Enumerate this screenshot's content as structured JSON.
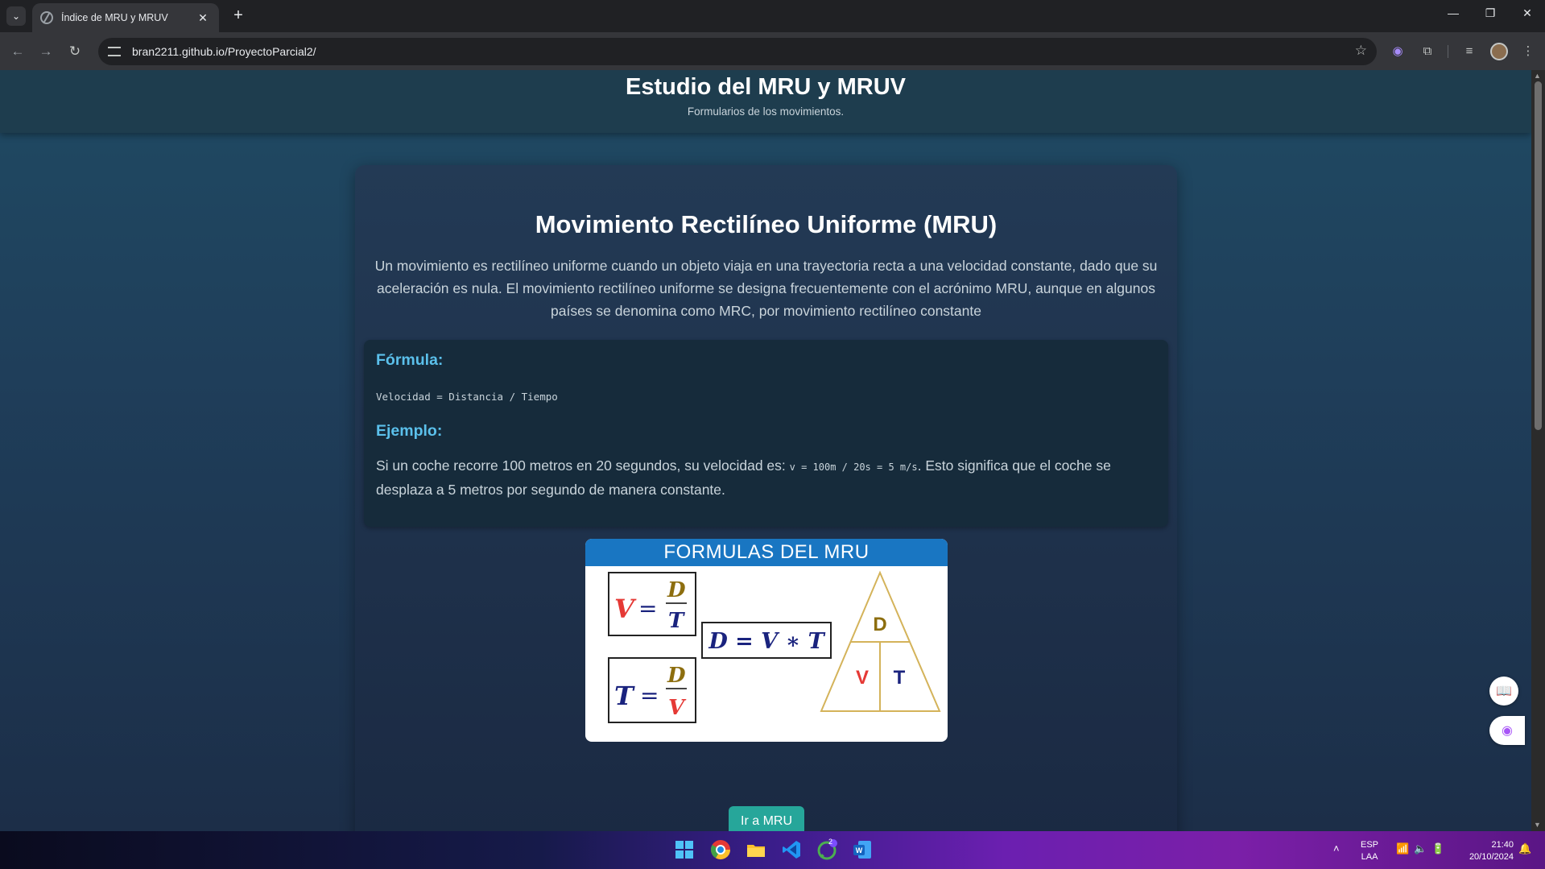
{
  "browser": {
    "tab_title": "Índice de MRU y MRUV",
    "url": "bran2211.github.io/ProyectoParcial2/"
  },
  "header": {
    "title": "Estudio del MRU y MRUV",
    "subtitle": "Formularios de los movimientos."
  },
  "mru": {
    "title": "Movimiento Rectilíneo Uniforme (MRU)",
    "description": "Un movimiento es rectilíneo uniforme cuando un objeto viaja en una trayectoria recta a una velocidad constante, dado que su aceleración es nula. El movimiento rectilíneo uniforme se designa frecuentemente con el acrónimo MRU, aunque en algunos países se denomina como MRC, por movimiento rectilíneo constante",
    "formula_heading": "Fórmula:",
    "formula_code": "Velocidad = Distancia / Tiempo",
    "example_heading": "Ejemplo:",
    "example_before": "Si un coche recorre 100 metros en 20 segundos, su velocidad es: ",
    "example_code": "v = 100m / 20s = 5 m/s",
    "example_after": ". Esto significa que el coche se desplaza a 5 metros por segundo de manera constante.",
    "image": {
      "heading": "FORMULAS DEL MRU",
      "formula_v": {
        "left": "V",
        "top": "D",
        "bottom": "T"
      },
      "formula_t": {
        "left": "T",
        "top": "D",
        "bottom": "V"
      },
      "formula_d": "D = V ∗ T",
      "triangle": {
        "top": "D",
        "left": "V",
        "right": "T"
      }
    },
    "button_label": "Ir a MRU"
  },
  "taskbar": {
    "lang_top": "ESP",
    "lang_bottom": "LAA",
    "time": "21:40",
    "date": "20/10/2024",
    "whatsapp_badge": "2"
  },
  "colors": {
    "accent_cyan": "#5bc0eb",
    "button_teal": "#26a69a",
    "formula_red": "#e53935",
    "formula_gold": "#8d6e0f",
    "formula_navy": "#1a237e"
  }
}
